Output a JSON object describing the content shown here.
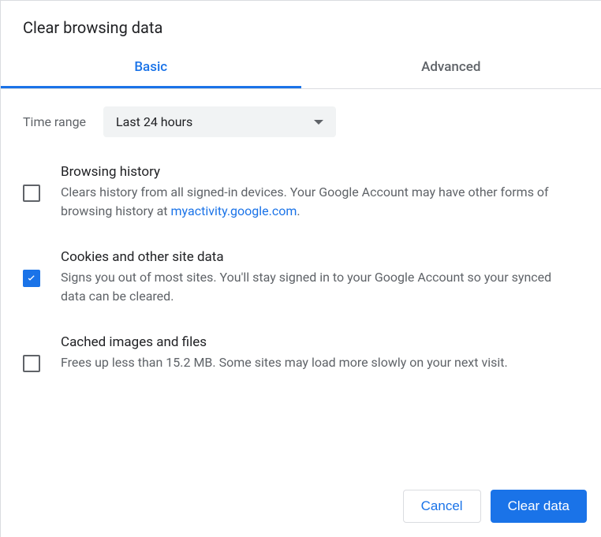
{
  "dialog": {
    "title": "Clear browsing data"
  },
  "tabs": {
    "basic": "Basic",
    "advanced": "Advanced"
  },
  "timeRange": {
    "label": "Time range",
    "value": "Last 24 hours"
  },
  "options": {
    "browsingHistory": {
      "title": "Browsing history",
      "desc_before": "Clears history from all signed-in devices. Your Google Account may have other forms of browsing history at ",
      "link": "myactivity.google.com",
      "desc_after": ".",
      "checked": false
    },
    "cookies": {
      "title": "Cookies and other site data",
      "desc": "Signs you out of most sites. You'll stay signed in to your Google Account so your synced data can be cleared.",
      "checked": true
    },
    "cached": {
      "title": "Cached images and files",
      "desc": "Frees up less than 15.2 MB. Some sites may load more slowly on your next visit.",
      "checked": false
    }
  },
  "buttons": {
    "cancel": "Cancel",
    "clear": "Clear data"
  }
}
